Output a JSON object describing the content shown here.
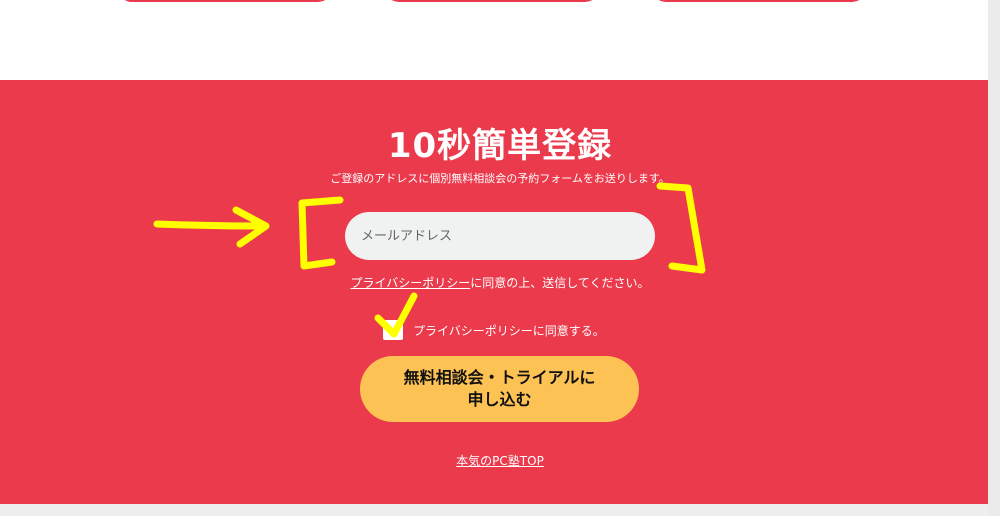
{
  "signup": {
    "title": "10秒簡単登録",
    "subtitle": "ご登録のアドレスに個別無料相談会の予約フォームをお送りします。",
    "email_placeholder": "メールアドレス",
    "consent_link": "プライバシーポリシー",
    "consent_text": "に同意の上、送信してください。",
    "checkbox_label": "プライバシーポリシーに同意する。",
    "cta_line1": "無料相談会・トライアルに",
    "cta_line2": "申し込む",
    "top_link": "本気のPC塾TOP"
  },
  "colors": {
    "section_bg": "#ea3a4c",
    "cta_bg": "#fdc254",
    "annotation": "#ffff00"
  }
}
